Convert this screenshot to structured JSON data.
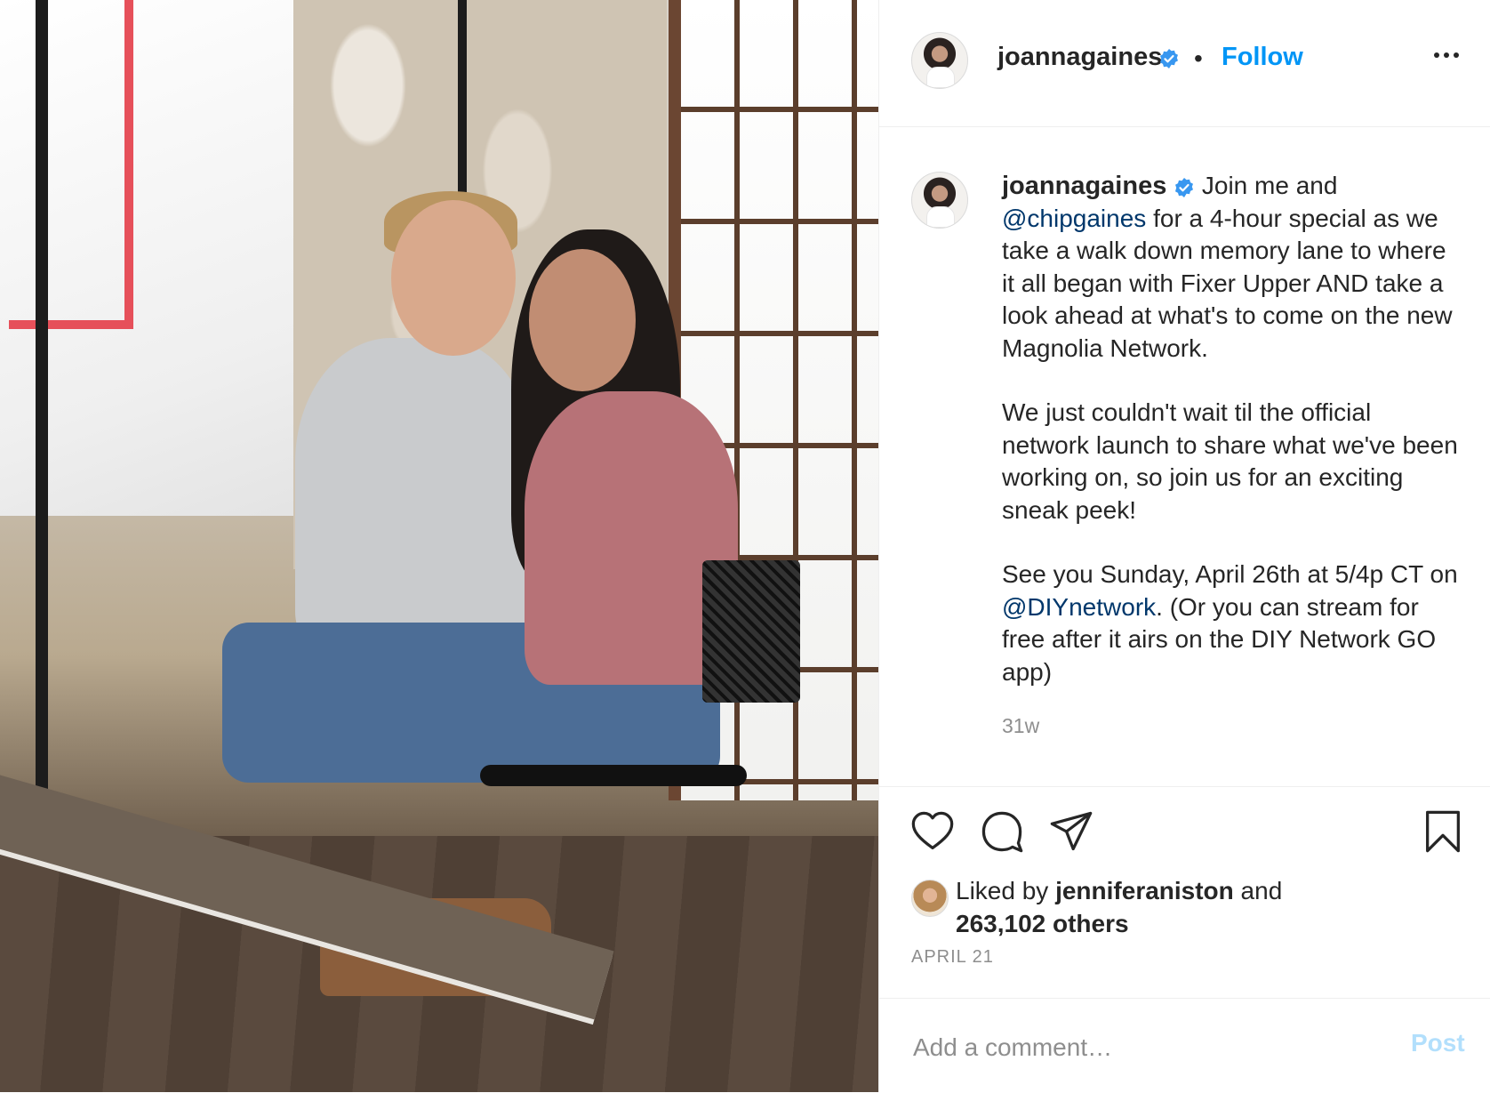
{
  "post": {
    "author": "joannagaines",
    "verified_icon": "verified-badge-icon",
    "separator": "•",
    "follow_label": "Follow",
    "more_icon": "more-options-icon",
    "caption": {
      "line1_rest": " Join me and",
      "mention1": "@chipgaines",
      "line2_rest": " for a 4-hour special as we take a walk down memory lane to where it all began with Fixer Upper AND take a look ahead at what's to come on the new Magnolia Network.",
      "para2": "We just couldn't wait til the official network launch to share what we've been working on, so join us for an exciting sneak peek!",
      "para3_start": "See you Sunday, April 26th at 5/4p CT on ",
      "mention2": "@DIYnetwork",
      "para3_end": ". (Or you can stream for free after it airs on the DIY Network GO app)"
    },
    "time_ago": "31w",
    "likes": {
      "prefix": "Liked by ",
      "user": "jenniferaniston",
      "middle": " and",
      "others": "263,102 others"
    },
    "date": "APRIL 21"
  },
  "actions": {
    "like_icon": "heart-icon",
    "comment_icon": "comment-bubble-icon",
    "share_icon": "paper-plane-icon",
    "save_icon": "bookmark-icon"
  },
  "comment": {
    "placeholder": "Add a comment…",
    "post_label": "Post"
  },
  "colors": {
    "follow_blue": "#0095f6",
    "mention_blue": "#00376b",
    "muted_gray": "#8e8e8e",
    "post_disabled": "#b2dffc",
    "verified_blue": "#3897f0"
  }
}
